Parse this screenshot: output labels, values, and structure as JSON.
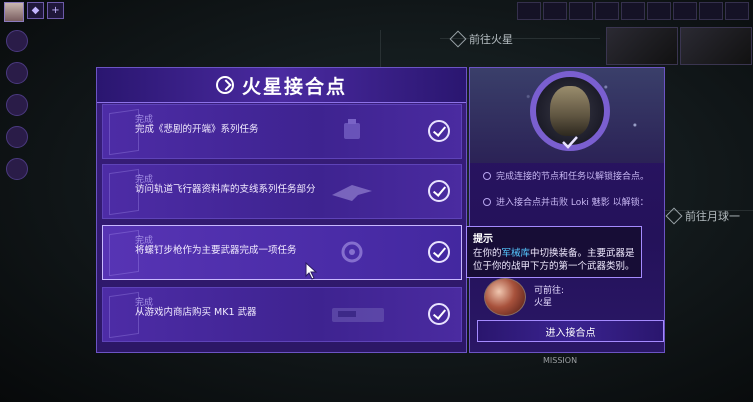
{
  "map": {
    "label_mars": "前往火星",
    "label_right": "前往月球一",
    "mission_tag": "MISSION"
  },
  "panel": {
    "title": "火星接合点",
    "tasks": [
      {
        "status": "完成",
        "desc": "完成《悲剧的开端》系列任务"
      },
      {
        "status": "完成",
        "desc": "访问轨道飞行器资料库的支线系列任务部分"
      },
      {
        "status": "完成",
        "desc": "将螺钉步枪作为主要武器完成一项任务"
      },
      {
        "status": "完成",
        "desc": "从游戏内商店购买 MK1 武器"
      }
    ],
    "info_lines": [
      "完成连接的节点和任务以解锁接合点。",
      "进入接合点并击败 Loki 魅影 以解锁："
    ],
    "tooltip": {
      "title": "提示",
      "part1": "在你的",
      "link": "军械库",
      "part2": "中切换装备。主要武器是位于你的战甲下方的第一个武器类别。"
    },
    "location": {
      "label": "可前往:",
      "name": "火星"
    },
    "enter_button": "进入接合点"
  },
  "colors": {
    "panel_bg": "#3a1f7e",
    "accent": "#a58bff",
    "link": "#55c8ff"
  }
}
